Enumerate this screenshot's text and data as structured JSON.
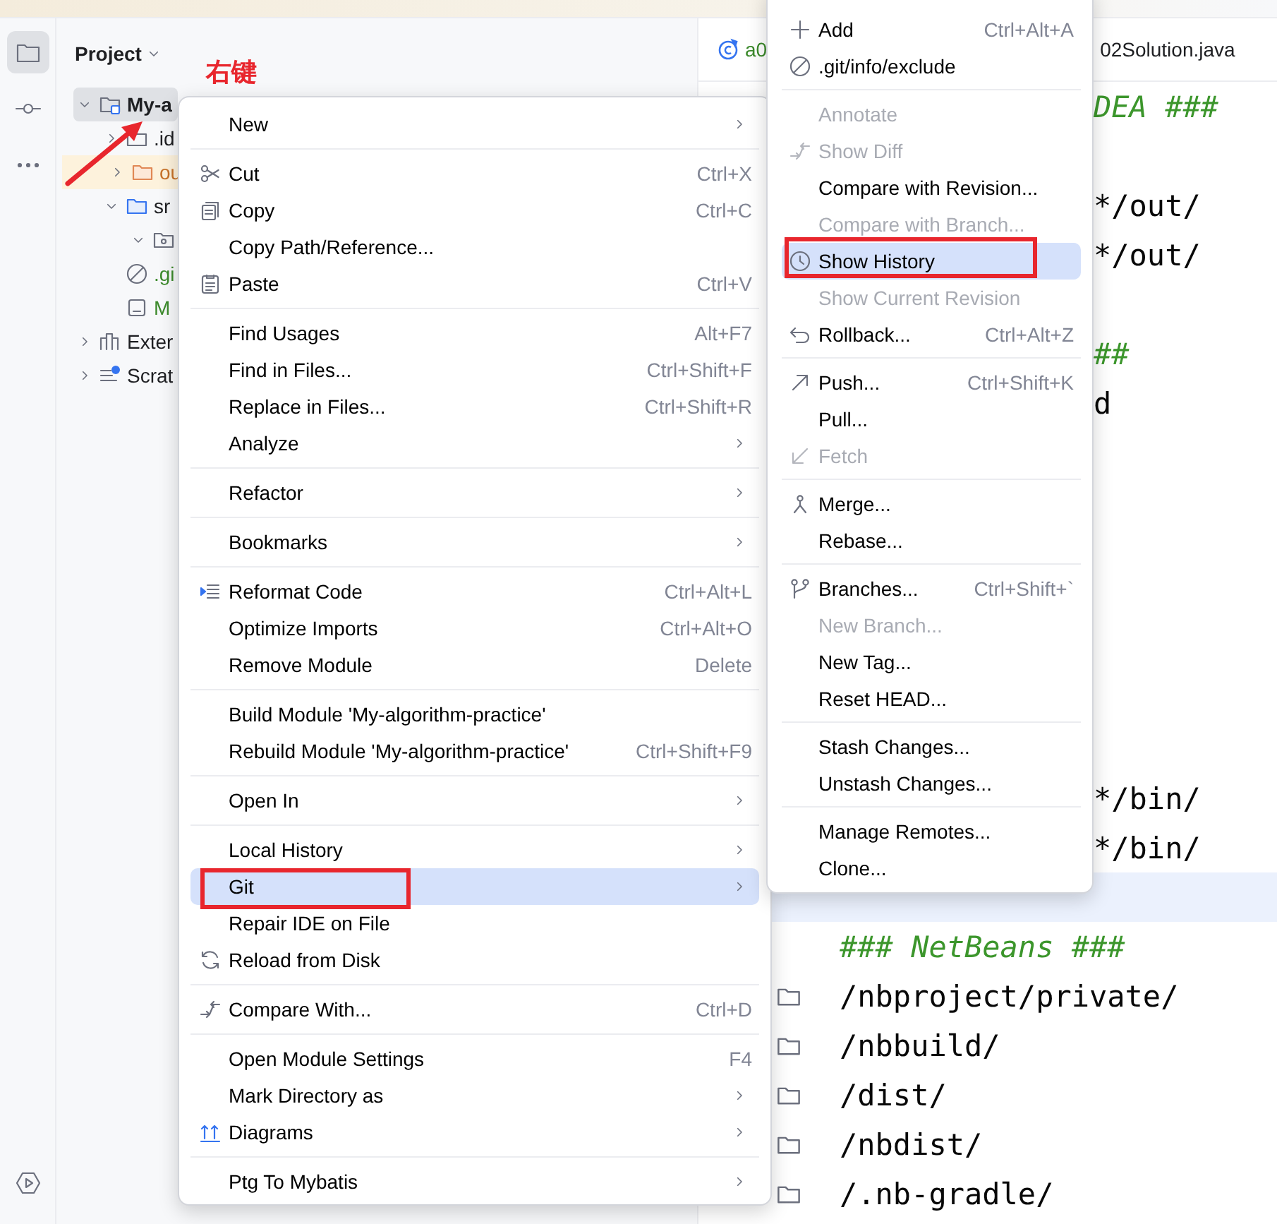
{
  "tool_strip": {
    "top": [
      {
        "selected": true
      },
      {
        "selected": false
      },
      {
        "selected": false
      }
    ],
    "bottom": [
      {
        "selected": false
      }
    ]
  },
  "project": {
    "title": "Project",
    "tree": [
      {
        "kind": "module",
        "label": "My-a",
        "expanded": true,
        "selected": true,
        "children": [
          {
            "kind": "folder",
            "label": ".id",
            "expanded": false
          },
          {
            "kind": "excluded",
            "label": "ou",
            "expanded": false
          },
          {
            "kind": "source",
            "label": "sr",
            "expanded": true,
            "children": [
              {
                "kind": "package",
                "expanded": true
              }
            ]
          },
          {
            "kind": "ignore",
            "label": ".gi"
          },
          {
            "kind": "file",
            "label": "M"
          }
        ]
      },
      {
        "kind": "library",
        "label": "Exter",
        "expanded": false
      },
      {
        "kind": "scratches",
        "label": "Scrat",
        "expanded": false
      }
    ]
  },
  "editor": {
    "tab": {
      "visible_parts": [
        "a0",
        "02Solution.java"
      ]
    },
    "lines": [
      {
        "kind": "comment",
        "text": "DEA ###",
        "partial": true,
        "current": false
      },
      {
        "kind": "blank",
        "current": false
      },
      {
        "kind": "path",
        "text": "*/out/",
        "partial": true,
        "current": false
      },
      {
        "kind": "path",
        "text": "*/out/",
        "partial": true,
        "current": false
      },
      {
        "kind": "blank",
        "current": false
      },
      {
        "kind": "comment",
        "text": "##",
        "partial": true,
        "current": false
      },
      {
        "kind": "path",
        "text": "d",
        "partial": true,
        "current": false
      },
      {
        "kind": "blank",
        "current": false
      },
      {
        "kind": "blank",
        "current": false
      },
      {
        "kind": "blank",
        "current": false
      },
      {
        "kind": "blank",
        "current": false
      },
      {
        "kind": "blank",
        "current": false
      },
      {
        "kind": "blank",
        "current": false
      },
      {
        "kind": "blank",
        "current": false
      },
      {
        "kind": "path",
        "text": "*/bin/",
        "partial": true,
        "current": false
      },
      {
        "kind": "path",
        "text": "*/bin/",
        "partial": true,
        "current": false
      },
      {
        "kind": "blank",
        "current": true
      },
      {
        "kind": "comment",
        "text": "### NetBeans ###",
        "partial": false,
        "current": false
      },
      {
        "kind": "path",
        "text": "/nbproject/private/",
        "partial": false,
        "current": false,
        "folder": true
      },
      {
        "kind": "path",
        "text": "/nbbuild/",
        "partial": false,
        "current": false,
        "folder": true
      },
      {
        "kind": "path",
        "text": "/dist/",
        "partial": false,
        "current": false,
        "folder": true
      },
      {
        "kind": "path",
        "text": "/nbdist/",
        "partial": false,
        "current": false,
        "folder": true
      },
      {
        "kind": "path",
        "text": "/.nb-gradle/",
        "partial": false,
        "current": false,
        "folder": true
      }
    ]
  },
  "context_menu": {
    "groups": [
      [
        {
          "label": "New",
          "submenu": true,
          "selected": false
        }
      ],
      [
        {
          "label": "Cut",
          "shortcut": "Ctrl+X",
          "selected": false
        },
        {
          "label": "Copy",
          "shortcut": "Ctrl+C",
          "selected": false
        },
        {
          "label": "Copy Path/Reference...",
          "selected": false
        },
        {
          "label": "Paste",
          "shortcut": "Ctrl+V",
          "selected": false
        }
      ],
      [
        {
          "label": "Find Usages",
          "shortcut": "Alt+F7",
          "selected": false
        },
        {
          "label": "Find in Files...",
          "shortcut": "Ctrl+Shift+F",
          "selected": false
        },
        {
          "label": "Replace in Files...",
          "shortcut": "Ctrl+Shift+R",
          "selected": false
        },
        {
          "label": "Analyze",
          "submenu": true,
          "selected": false
        }
      ],
      [
        {
          "label": "Refactor",
          "submenu": true,
          "selected": false
        }
      ],
      [
        {
          "label": "Bookmarks",
          "submenu": true,
          "selected": false
        }
      ],
      [
        {
          "label": "Reformat Code",
          "shortcut": "Ctrl+Alt+L",
          "selected": false
        },
        {
          "label": "Optimize Imports",
          "shortcut": "Ctrl+Alt+O",
          "selected": false
        },
        {
          "label": "Remove Module",
          "shortcut": "Delete",
          "selected": false
        }
      ],
      [
        {
          "label": "Build Module 'My-algorithm-practice'",
          "selected": false
        },
        {
          "label": "Rebuild Module 'My-algorithm-practice'",
          "shortcut": "Ctrl+Shift+F9",
          "selected": false
        }
      ],
      [
        {
          "label": "Open In",
          "submenu": true,
          "selected": false
        }
      ],
      [
        {
          "label": "Local History",
          "submenu": true,
          "selected": false
        },
        {
          "label": "Git",
          "submenu": true,
          "selected": true,
          "outlined": true
        },
        {
          "label": "Repair IDE on File",
          "selected": false
        },
        {
          "label": "Reload from Disk",
          "selected": false
        }
      ],
      [
        {
          "label": "Compare With...",
          "shortcut": "Ctrl+D",
          "selected": false
        }
      ],
      [
        {
          "label": "Open Module Settings",
          "shortcut": "F4",
          "selected": false
        },
        {
          "label": "Mark Directory as",
          "submenu": true,
          "selected": false
        },
        {
          "label": "Diagrams",
          "submenu": true,
          "selected": false
        }
      ],
      [
        {
          "label": "Ptg To Mybatis",
          "submenu": true,
          "selected": false
        }
      ]
    ]
  },
  "git_submenu": {
    "groups": [
      [
        {
          "label": "Add",
          "shortcut": "Ctrl+Alt+A",
          "disabled": false,
          "selected": false
        },
        {
          "label": ".git/info/exclude",
          "disabled": false,
          "selected": false
        }
      ],
      [
        {
          "label": "Annotate",
          "disabled": true,
          "selected": false
        },
        {
          "label": "Show Diff",
          "disabled": true,
          "selected": false
        },
        {
          "label": "Compare with Revision...",
          "disabled": false,
          "selected": false
        },
        {
          "label": "Compare with Branch...",
          "disabled": true,
          "selected": false
        },
        {
          "label": "Show History",
          "disabled": false,
          "selected": true,
          "outlined": true
        },
        {
          "label": "Show Current Revision",
          "disabled": true,
          "selected": false
        },
        {
          "label": "Rollback...",
          "shortcut": "Ctrl+Alt+Z",
          "disabled": false,
          "selected": false
        }
      ],
      [
        {
          "label": "Push...",
          "shortcut": "Ctrl+Shift+K",
          "disabled": false,
          "selected": false
        },
        {
          "label": "Pull...",
          "disabled": false,
          "selected": false
        },
        {
          "label": "Fetch",
          "disabled": true,
          "selected": false
        }
      ],
      [
        {
          "label": "Merge...",
          "disabled": false,
          "selected": false
        },
        {
          "label": "Rebase...",
          "disabled": false,
          "selected": false
        }
      ],
      [
        {
          "label": "Branches...",
          "shortcut": "Ctrl+Shift+`",
          "disabled": false,
          "selected": false
        },
        {
          "label": "New Branch...",
          "disabled": true,
          "selected": false
        },
        {
          "label": "New Tag...",
          "disabled": false,
          "selected": false
        },
        {
          "label": "Reset HEAD...",
          "disabled": false,
          "selected": false
        }
      ],
      [
        {
          "label": "Stash Changes...",
          "disabled": false,
          "selected": false
        },
        {
          "label": "Unstash Changes...",
          "disabled": false,
          "selected": false
        }
      ],
      [
        {
          "label": "Manage Remotes...",
          "disabled": false,
          "selected": false
        },
        {
          "label": "Clone...",
          "disabled": false,
          "selected": false
        }
      ]
    ]
  },
  "annotation": {
    "label": "右键"
  }
}
